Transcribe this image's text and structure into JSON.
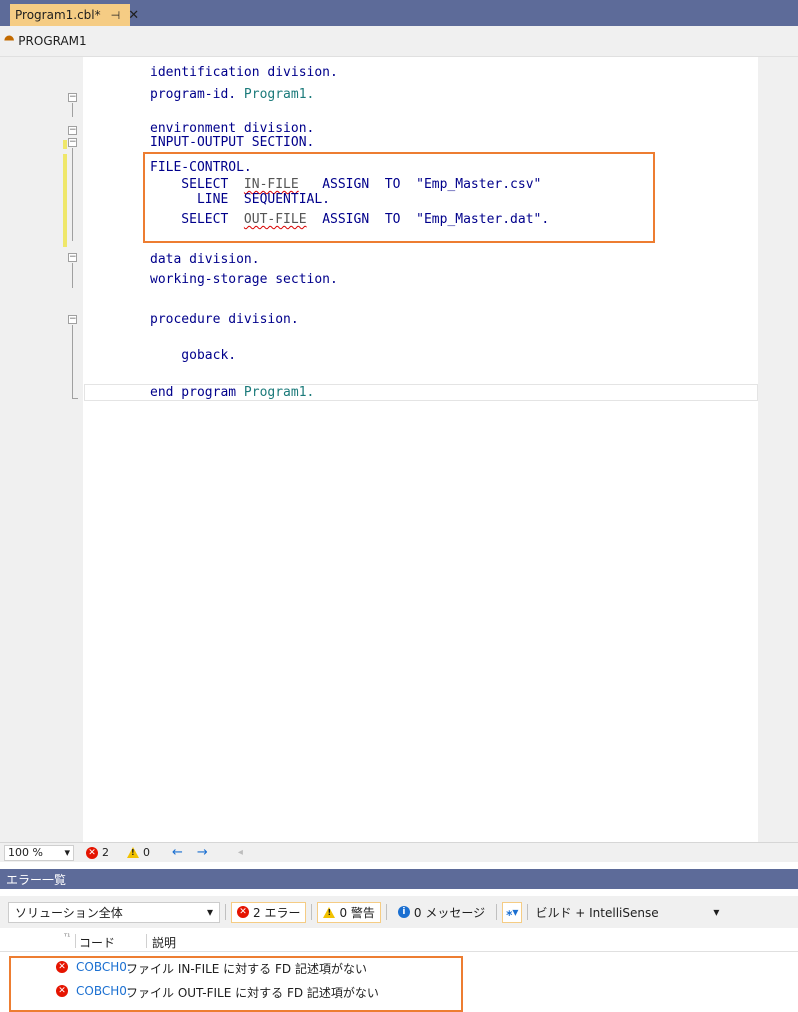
{
  "tab": {
    "title": "Program1.cbl*",
    "pin": "⊣",
    "close": "✕"
  },
  "navbar": {
    "label": "PROGRAM1"
  },
  "code": {
    "l1": "identification division.",
    "l2a": "program-id. ",
    "l2b": "Program1.",
    "l3": "environment division.",
    "l4": "INPUT-OUTPUT SECTION.",
    "l5": "FILE-CONTROL.",
    "l6a": "    SELECT  ",
    "l6b": "IN-FILE",
    "l6c": "   ASSIGN  TO  ",
    "l6d": "\"Emp_Master.csv\"",
    "l7": "      LINE  SEQUENTIAL.",
    "l8a": "    SELECT  ",
    "l8b": "OUT-FILE",
    "l8c": "  ASSIGN  TO  ",
    "l8d": "\"Emp_Master.dat\".",
    "l9": "data division.",
    "l10": "working-storage section.",
    "l11": "procedure division.",
    "l12": "    goback.",
    "l13a": "end program ",
    "l13b": "Program1."
  },
  "statusbar": {
    "zoom": "100 %",
    "errors": "2",
    "warnings": "0",
    "back": "←",
    "forward": "→",
    "scroll": "◂"
  },
  "error_list": {
    "title": "エラー一覧",
    "scope": "ソリューション全体",
    "errors_btn": "2 エラー",
    "warnings_btn": "0 警告",
    "messages_btn": "0 メッセージ",
    "build_filter": "ビルド + IntelliSense",
    "col_code": "コード",
    "col_desc": "説明",
    "rows": [
      {
        "code": "COBCH0:",
        "desc": "ファイル IN-FILE に対する FD 記述項がない"
      },
      {
        "code": "COBCH0:",
        "desc": "ファイル OUT-FILE に対する FD 記述項がない"
      }
    ]
  },
  "colors": {
    "accent": "#5d6b99",
    "tab_active": "#f5cc84",
    "highlight": "#ed7d31",
    "error": "#e51400",
    "warning": "#f2c200",
    "info": "#1a6fd1"
  }
}
